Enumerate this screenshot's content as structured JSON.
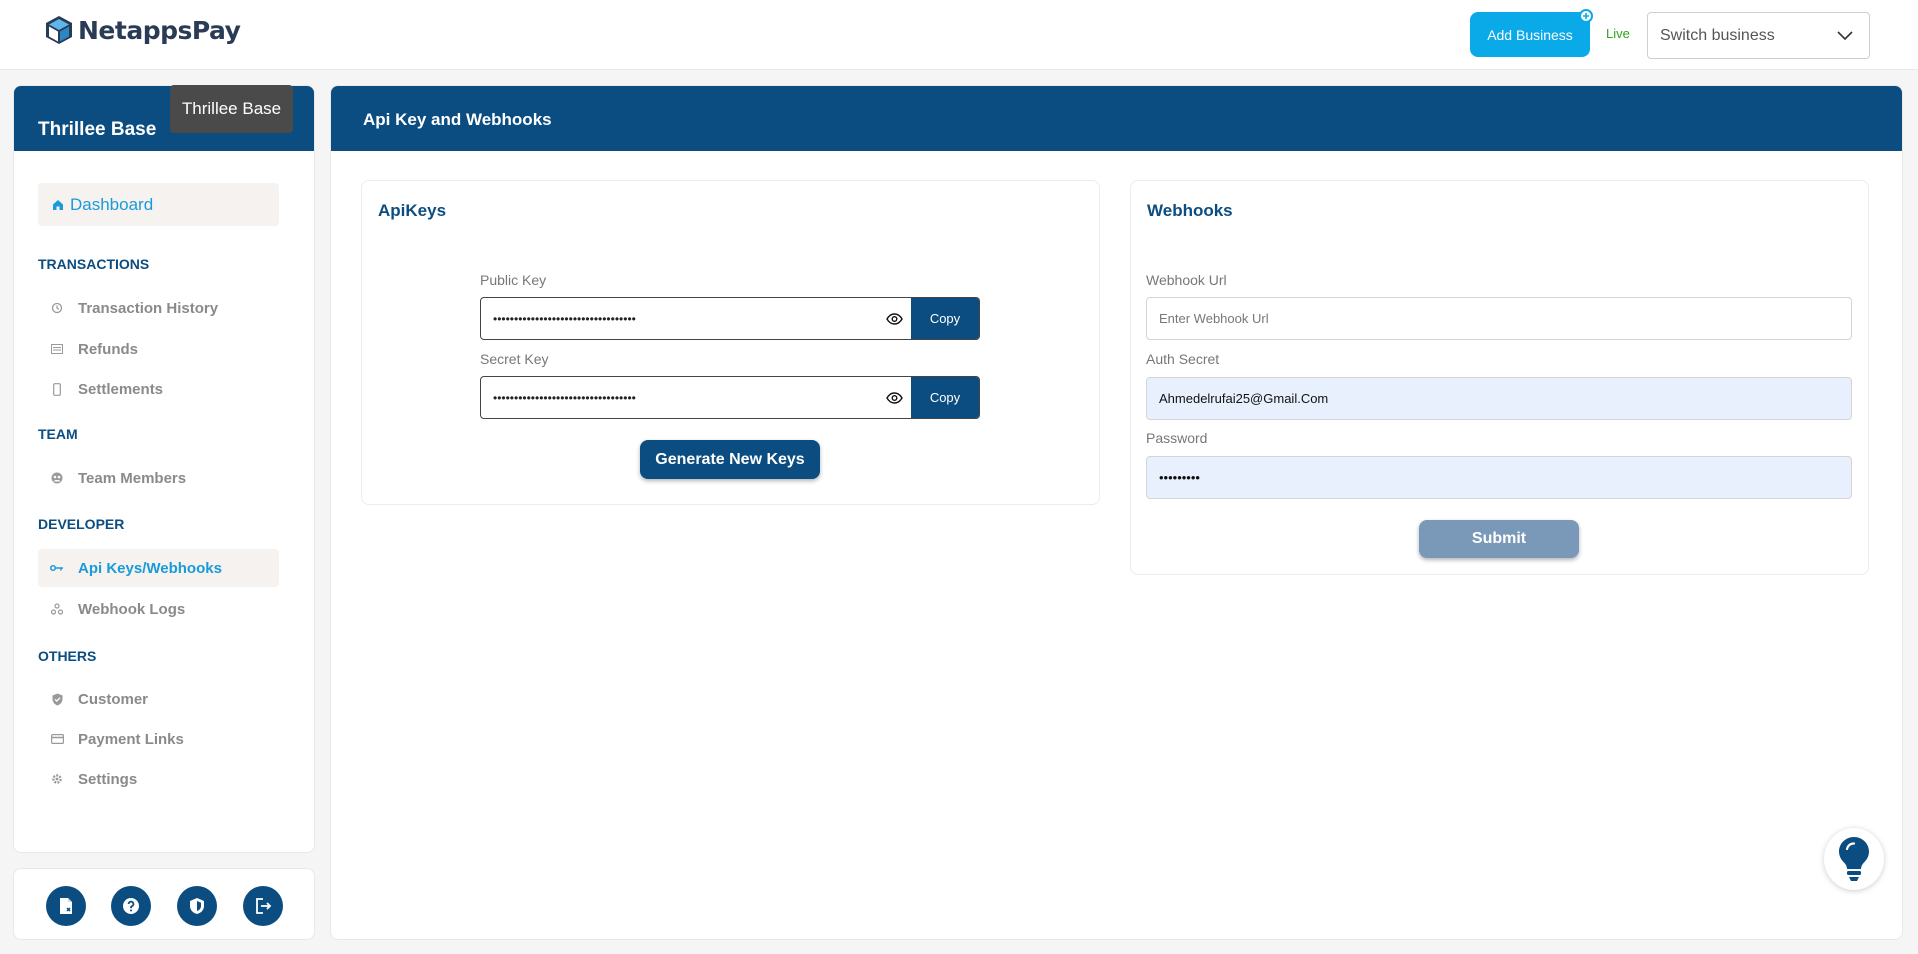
{
  "brand": {
    "name": "NetappsPay"
  },
  "header": {
    "add_business_label": "Add Business",
    "mode_label": "Live",
    "switch_business_placeholder": "Switch business"
  },
  "sidebar": {
    "business_name": "Thrillee Base",
    "tooltip": "Thrillee Base",
    "dashboard_label": "Dashboard",
    "sections": {
      "transactions": "TRANSACTIONS",
      "team": "TEAM",
      "developer": "DEVELOPER",
      "others": "OTHERS"
    },
    "items": {
      "transaction_history": "Transaction History",
      "refunds": "Refunds",
      "settlements": "Settlements",
      "team_members": "Team Members",
      "api_keys": "Api Keys/Webhooks",
      "webhook_logs": "Webhook Logs",
      "customer": "Customer",
      "payment_links": "Payment Links",
      "settings": "Settings"
    }
  },
  "main": {
    "title": "Api Key and Webhooks",
    "apikeys": {
      "title": "ApiKeys",
      "public_key_label": "Public Key",
      "public_key_value": "••••••••••••••••••••••••••••••••••",
      "secret_key_label": "Secret Key",
      "secret_key_value": "••••••••••••••••••••••••••••••••••",
      "copy_label": "Copy",
      "generate_label": "Generate New Keys"
    },
    "webhooks": {
      "title": "Webhooks",
      "url_label": "Webhook Url",
      "url_placeholder": "Enter Webhook Url",
      "auth_label": "Auth Secret",
      "auth_value": "Ahmedelrufai25@Gmail.Com",
      "password_label": "Password",
      "password_value": "•••••••••",
      "submit_label": "Submit"
    }
  },
  "colors": {
    "primary": "#0b4d81",
    "accent": "#1a9bd9",
    "add_business": "#0aa9e8",
    "live": "#2ca61c"
  }
}
